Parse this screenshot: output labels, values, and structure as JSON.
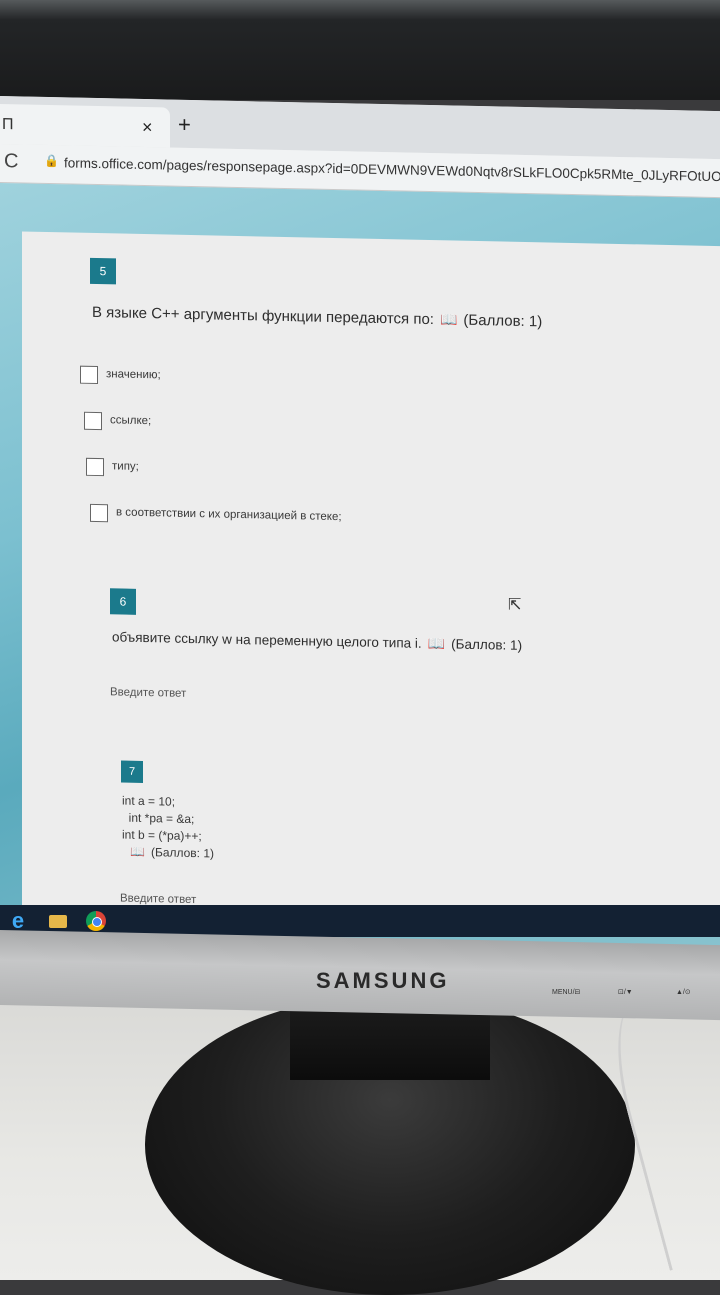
{
  "browser": {
    "tab_title": "П",
    "close_glyph": "×",
    "new_tab_glyph": "+",
    "reload_glyph": "C",
    "url": "forms.office.com/pages/responsepage.aspx?id=0DEVMWN9VEWd0Nqtv8rSLkFLO0Cpk5RMte_0JLyRFOtUOE"
  },
  "form": {
    "q5": {
      "number": "5",
      "text": "В языке С++ аргументы функции передаются по:",
      "points": "(Баллов: 1)",
      "options": [
        "значению;",
        "ссылке;",
        "типу;",
        "в соответствии с их организацией в стеке;"
      ]
    },
    "q6": {
      "number": "6",
      "text": "объявите ссылку w на переменную целого типа i.",
      "points": "(Баллов: 1)",
      "answer_placeholder": "Введите ответ"
    },
    "q7": {
      "number": "7",
      "code_lines": [
        "int a = 10;",
        "  int *pa = &a;",
        "int b = (*pa)++;"
      ],
      "points": "(Баллов: 1)",
      "answer_placeholder": "Введите ответ"
    }
  },
  "monitor": {
    "brand": "SAMSUNG",
    "menu_label": "MENU/⊟",
    "button2_label": "⊡/▼",
    "button3_label": "▲/⊙"
  },
  "colors": {
    "question_badge": "#1b7a8c",
    "page_accent": "#7cc0d0",
    "taskbar": "#132133"
  },
  "icons": [
    "immersive-reader-icon",
    "lock-icon",
    "reload-icon",
    "ie-icon",
    "folder-icon",
    "chrome-icon",
    "mouse-cursor-icon"
  ]
}
